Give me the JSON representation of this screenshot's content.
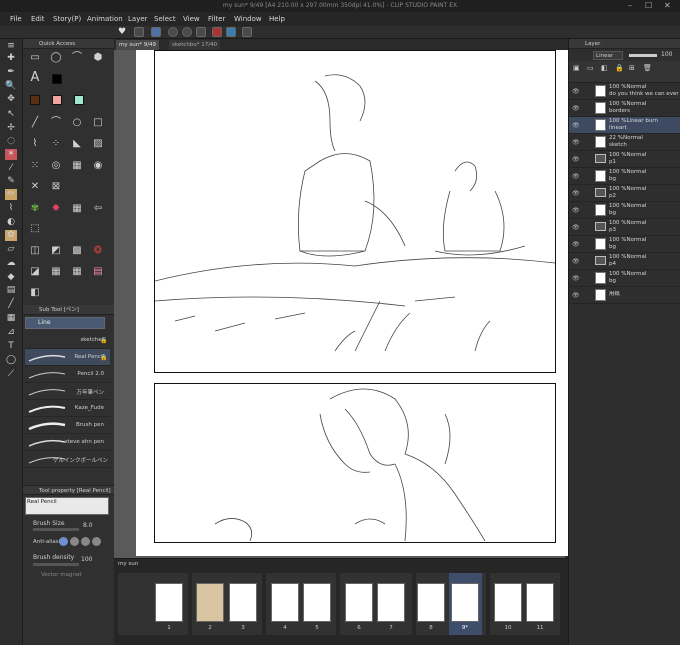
{
  "titlebar": {
    "title": "my sun* 9/49 [A4 210.00 x 297.00mm 350dpi 41.0%] - CLIP STUDIO PAINT EX",
    "min": "–",
    "max": "☐",
    "close": "✕"
  },
  "menu": [
    "File",
    "Edit",
    "Story(P)",
    "Animation",
    "Layer",
    "Select",
    "View",
    "Filter",
    "Window",
    "Help"
  ],
  "tabs": [
    {
      "label": "my sun*",
      "count": "9/49"
    },
    {
      "label": "sketchbo*",
      "count": "17/40"
    }
  ],
  "quick_access": {
    "title": "Quick Access"
  },
  "sub_tool": {
    "title": "Sub Tool [ペン]",
    "group": "Line",
    "brushes": [
      {
        "name": "sketcher",
        "locked": true
      },
      {
        "name": "Real Pencil",
        "locked": true,
        "selected": true
      },
      {
        "name": "Pencil 2.0",
        "locked": false
      },
      {
        "name": "万年筆ペン",
        "locked": false
      },
      {
        "name": "Kaze_Fude",
        "locked": false
      },
      {
        "name": "Brush pen",
        "locked": false
      },
      {
        "name": "steve ahn pen",
        "locked": false
      },
      {
        "name": "ゲルインクボールペン",
        "locked": false
      }
    ]
  },
  "tool_property": {
    "title": "Tool property [Real Pencil]",
    "preset": "Real Pencil",
    "brush_size_label": "Brush Size",
    "brush_size": "8.0",
    "anti_alias_label": "Anti-aliasing",
    "density_label": "Brush density",
    "density": "100",
    "vector_magnet": "Vector magnet"
  },
  "layer_panel": {
    "title": "Layer",
    "blend_mode": "Linear bur",
    "opacity": "100",
    "layers": [
      {
        "l1": "100 %Normal",
        "l2": "do you think we can ever",
        "type": "text",
        "indent": false,
        "selected": false
      },
      {
        "l1": "100 %Normal",
        "l2": "borders",
        "type": "raster",
        "indent": false,
        "selected": false
      },
      {
        "l1": "100 %Linear burn",
        "l2": "lineart",
        "type": "raster",
        "indent": false,
        "selected": true
      },
      {
        "l1": "22 %Normal",
        "l2": "sketch",
        "type": "raster",
        "indent": false,
        "selected": false
      },
      {
        "l1": "100 %Normal",
        "l2": "p1",
        "type": "folder",
        "indent": false,
        "selected": false
      },
      {
        "l1": "100 %Normal",
        "l2": "bg",
        "type": "raster",
        "indent": true,
        "selected": false
      },
      {
        "l1": "100 %Normal",
        "l2": "p2",
        "type": "folder",
        "indent": false,
        "selected": false
      },
      {
        "l1": "100 %Normal",
        "l2": "bg",
        "type": "raster",
        "indent": true,
        "selected": false
      },
      {
        "l1": "100 %Normal",
        "l2": "p3",
        "type": "folder",
        "indent": false,
        "selected": false
      },
      {
        "l1": "100 %Normal",
        "l2": "bg",
        "type": "raster",
        "indent": true,
        "selected": false
      },
      {
        "l1": "100 %Normal",
        "l2": "p4",
        "type": "folder",
        "indent": false,
        "selected": false
      },
      {
        "l1": "100 %Normal",
        "l2": "bg",
        "type": "raster",
        "indent": true,
        "selected": false
      },
      {
        "l1": "用紙",
        "l2": "",
        "type": "paper",
        "indent": false,
        "selected": false
      }
    ]
  },
  "thumbnails": {
    "title": "my sun",
    "pages": [
      "1",
      "2",
      "3",
      "4",
      "5",
      "6",
      "7",
      "8",
      "9*",
      "10",
      "11"
    ],
    "current": "9*"
  },
  "colors": {
    "accent": "#4e6fa8",
    "swatch_brown": "#5a2e12",
    "swatch_pink": "#f4a4a0",
    "swatch_mint": "#9ee8cf"
  }
}
